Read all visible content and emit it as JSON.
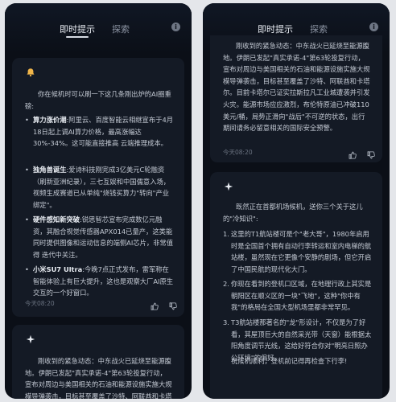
{
  "tabs": {
    "instant": "即时提示",
    "search": "探索"
  },
  "info_icon": "ⓘ",
  "left": {
    "card1": {
      "icon": "bell-icon",
      "intro": "你在候机时可以刷一下这几条刚出炉的AI圈重磅:",
      "items": [
        {
          "title": "算力涨价潮",
          "text": ":阿里云、百度智能云相继宣布于4月18日起上调AI算力价格，最高涨幅达30%-34%。这可能直接推高 云端推理成本。"
        },
        {
          "title": "独角兽诞生",
          "text": ":爱诗科技刚完成3亿美元C轮融资（刷新亚洲纪录），三七互娱和中国儒意入场，视频生成赛道已从单纯\"烧钱买算力\"转向\"产业绑定\"。"
        },
        {
          "title": "硬件感知新突破",
          "text": ":锐思智芯宣布完成数亿元融资，其融合视觉传感器APX014已量产，这类能同时提供图像和运动信息的端侧AI芯片，非常值得 迭代中关注。"
        },
        {
          "title": "小米SU7 Ultra",
          "text": ":今晚7点正式发布，雷军称在智能体验上有巨大提升，这也是观察大厂AI原生交互的一个好窗口。"
        }
      ],
      "time": "今天08:20"
    },
    "card2": {
      "icon": "sparkle-icon",
      "text": "刚收到的紧急动态：中东战火已延烧至能源腹地。伊朗已发起\"真实承诺-4\"第63轮投复行动，宣布对周边与美国相关的石油和能源设施实施大规模导弹袭击，目标甚至覆盖了沙特、阿联酋和卡塔尔。"
    }
  },
  "right": {
    "card1": {
      "text": "刚收到的紧急动态：中东战火已延烧至能源腹地。伊朗已发起\"真实承诺-4\"第63轮投复行动，宣布对周边与美国相关的石油和能源设施实施大规模导弹袭击，目标甚至覆盖了沙特、阿联酋和卡塔尔。目前卡塔尔已证实拉斯拉凡工业城遭袭并引发火灾。能源市场应应激烈，布伦特原油已冲破110美元/桶，局势正滑向\"战后\"不可逆的状态，出行期间请务必留意相关的国际安全预警。",
      "time": "今天08:20"
    },
    "card2": {
      "icon": "sparkle-icon",
      "intro": "既然正在首都机场候机，送你三个关于这儿的\"冷知识\":",
      "items": [
        {
          "num": "1.",
          "text": "这里的T1航站楼可是个\"老大哥\"，1980年启用时是全国首个拥有自动行李转运和室内电梯的航站楼，虽然现在它更像个安静的剧场，但它开启了中国民航的现代化大门。"
        },
        {
          "num": "2.",
          "text": "你现在看到的登机口区域，在地理行政上其实是朝阳区在顺义区的一块\"飞地\"，这种\"你中有我\"的格局在全国大型机场里都非常罕见。"
        },
        {
          "num": "3.",
          "text": "T3航站楼那著名的\"龙\"形设计，不仅是为了好看，其屋顶巨大的自然采光带（天窗）能根据太阳角度调节光线，这给好符合你对\"明亮日照办公环境\"的偏好。"
        }
      ],
      "outro": "祝候机顺利，登机前记得再检查下行李!"
    }
  },
  "colors": {
    "page_bg": "#e4e6ea",
    "app_bg": "#0b0f17",
    "card_bg": "#141a25",
    "bell": "#f1b64a"
  }
}
